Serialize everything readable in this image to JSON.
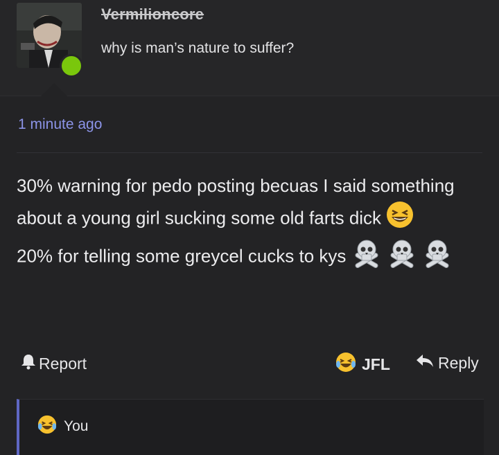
{
  "post": {
    "username": "Vermilioncore",
    "user_title": "why is man’s nature to suffer?",
    "timestamp": "1 minute ago",
    "body_line1": "30% warning for pedo posting becuas I said something about a young girl sucking some old farts dick",
    "body_line2": "20% for telling some greycel cucks to kys",
    "icons": [
      "laughing-emoji",
      "skull-crossbones-emoji",
      "crying-laughing-emoji"
    ]
  },
  "actions": {
    "report_label": "Report",
    "reaction_label": "JFL",
    "reply_label": "Reply"
  },
  "quote": {
    "label": "You"
  },
  "colors": {
    "background": "#232325",
    "link": "#8c94e8",
    "online": "#7ac70c",
    "quote_accent": "#5f67c4"
  }
}
